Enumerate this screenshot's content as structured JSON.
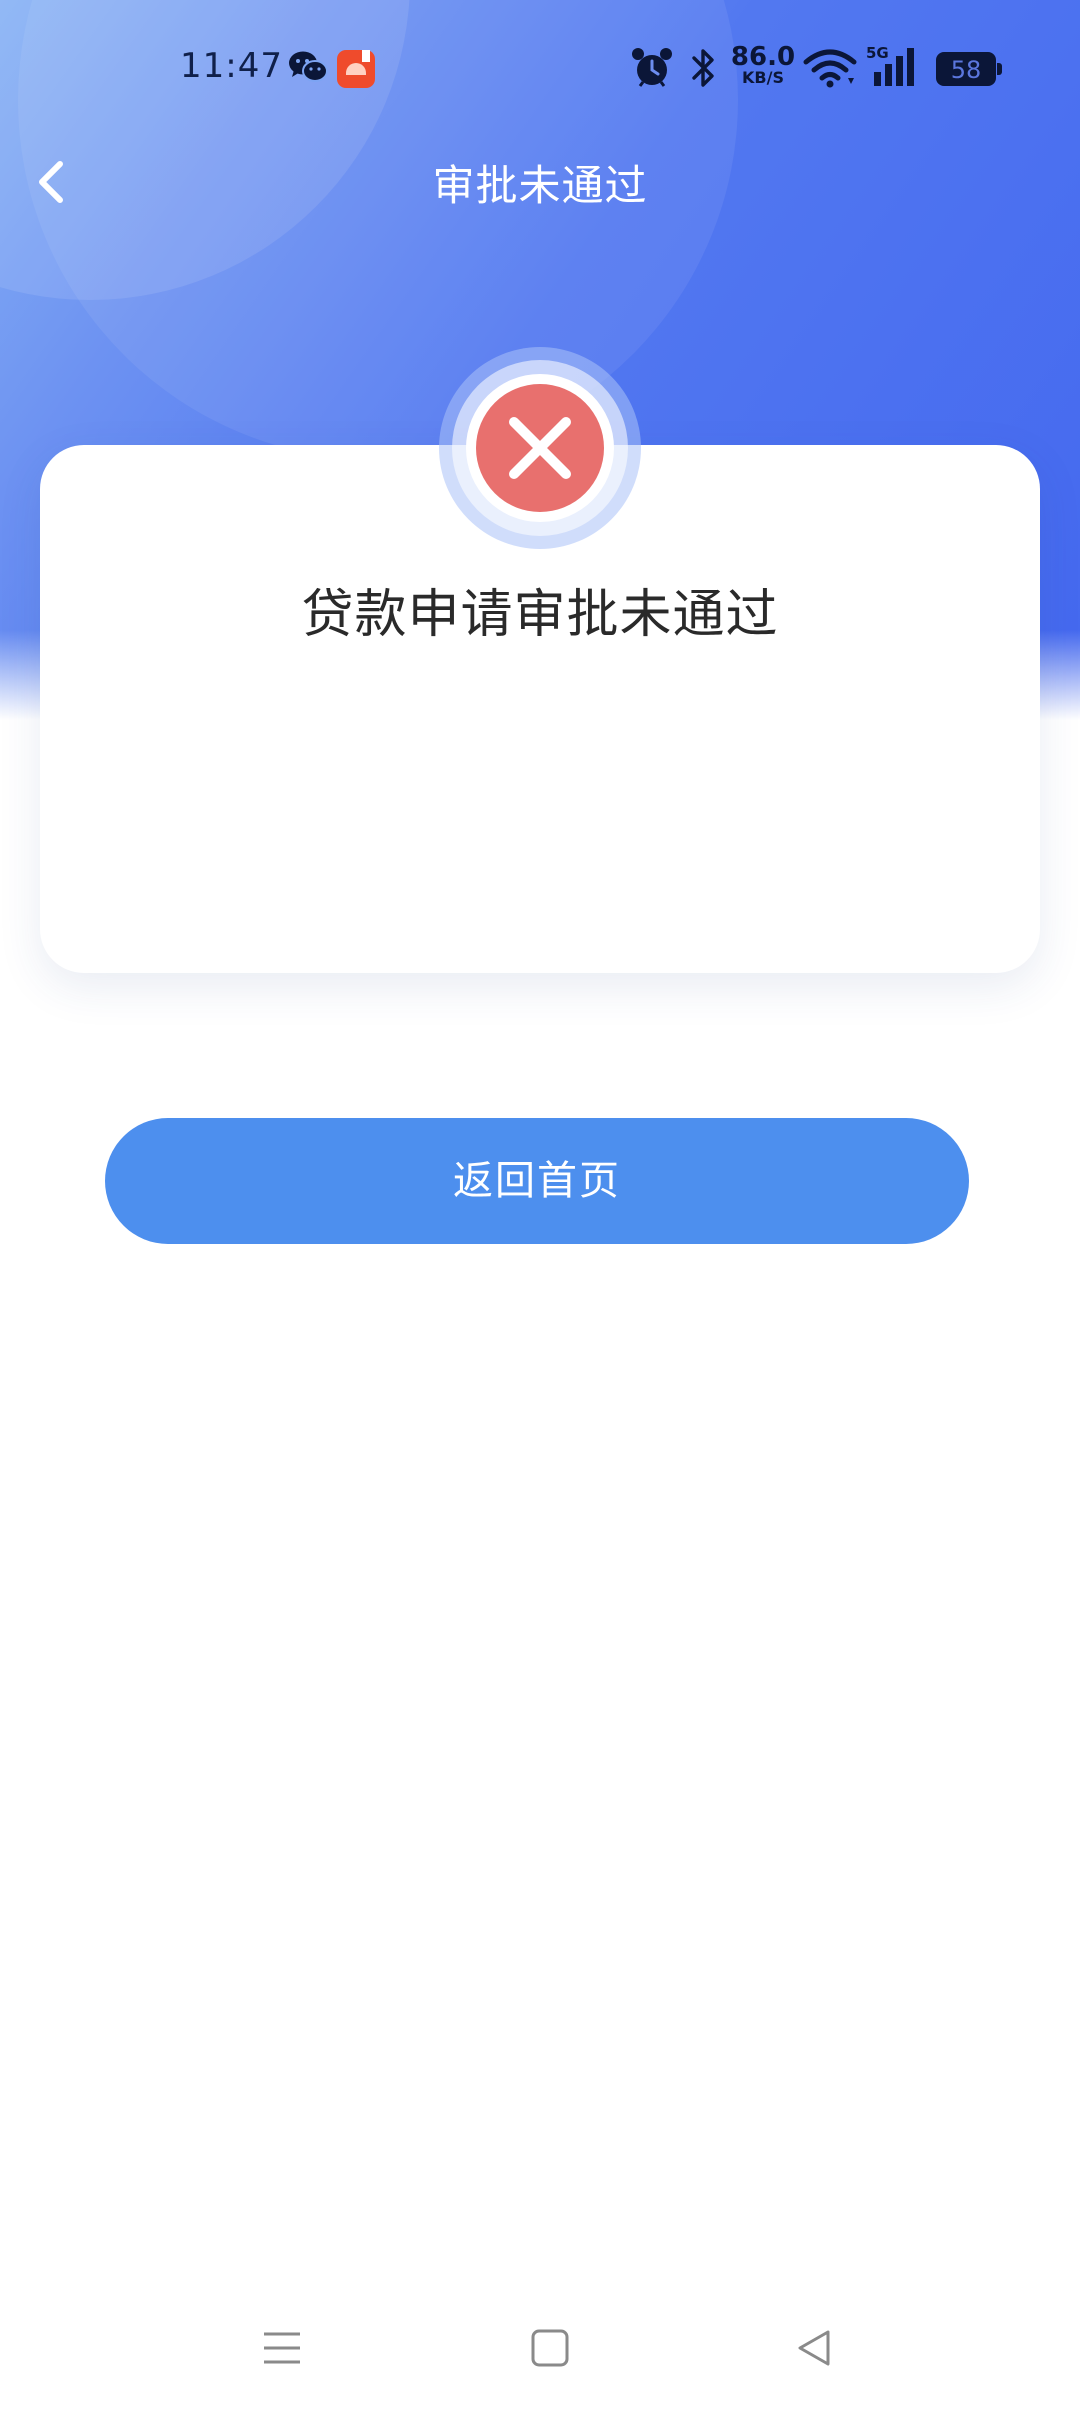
{
  "status_bar": {
    "time": "11:47",
    "net_speed": "86.0",
    "net_speed_unit": "KB/S",
    "network_type": "5G",
    "battery": "58",
    "icons": [
      "wechat-icon",
      "app-notification-icon",
      "alarm-icon",
      "bluetooth-icon",
      "wifi-icon",
      "signal-icon",
      "battery-icon"
    ]
  },
  "header": {
    "title": "审批未通过",
    "back_icon": "chevron-left-icon"
  },
  "result": {
    "icon": "close-circle-icon",
    "message": "贷款申请审批未通过"
  },
  "actions": {
    "home_label": "返回首页"
  },
  "system_nav": {
    "icons": [
      "menu-icon",
      "home-square-icon",
      "back-triangle-icon"
    ]
  },
  "colors": {
    "header_gradient_start": "#86b1f4",
    "header_gradient_end": "#4468ef",
    "error_red": "#e8706e",
    "button_blue": "#4d8fee"
  }
}
